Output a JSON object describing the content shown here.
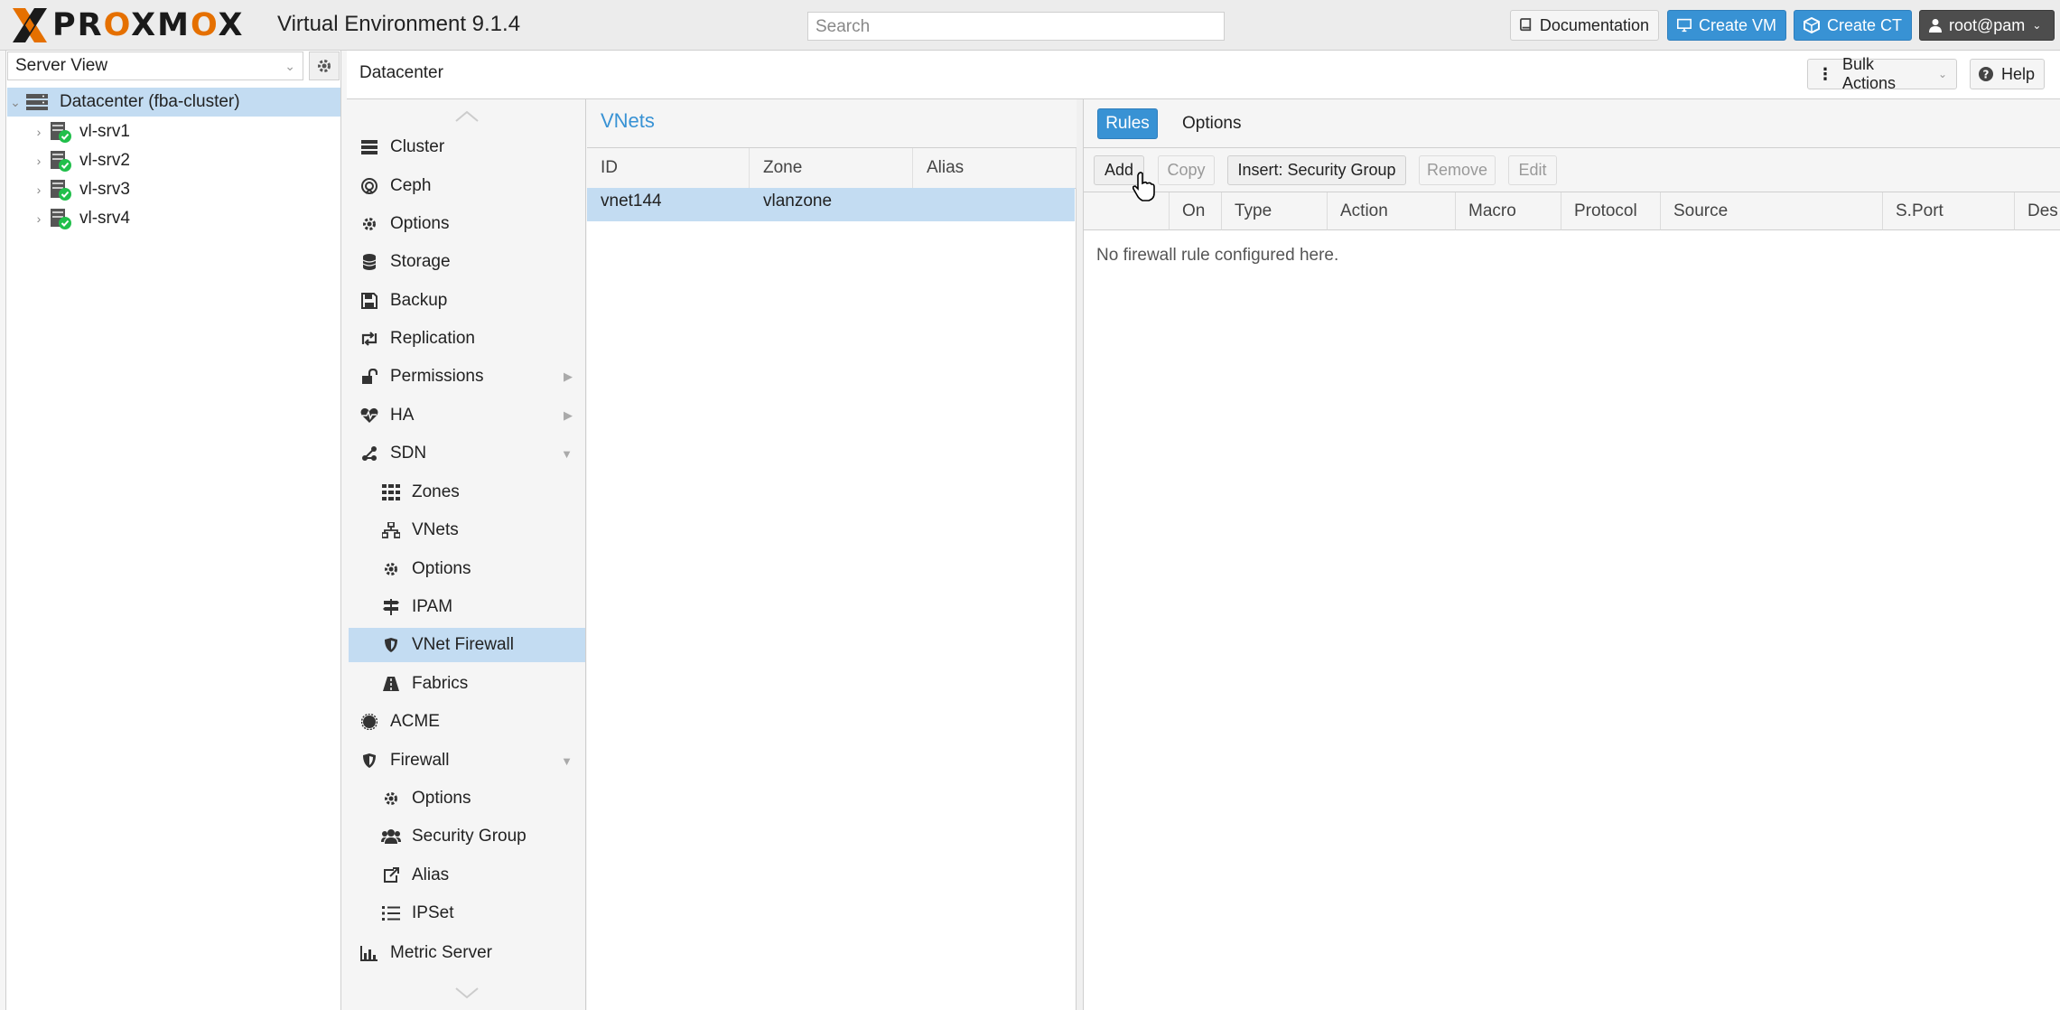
{
  "header": {
    "logo_text": "PROXMOX",
    "product_title": "Virtual Environment 9.1.4",
    "search_placeholder": "Search",
    "buttons": {
      "documentation": "Documentation",
      "create_vm": "Create VM",
      "create_ct": "Create CT",
      "user": "root@pam"
    },
    "accent_color": "#3892d4",
    "brand_color": "#e57000"
  },
  "resource_tree": {
    "view_select": "Server View",
    "datacenter": "Datacenter (fba-cluster)",
    "nodes": [
      "vl-srv1",
      "vl-srv2",
      "vl-srv3",
      "vl-srv4"
    ]
  },
  "content": {
    "title": "Datacenter",
    "bulk_actions": "Bulk Actions",
    "help": "Help"
  },
  "nav": {
    "items": [
      {
        "label": "Cluster",
        "icon": "server-icon"
      },
      {
        "label": "Ceph",
        "icon": "ceph-icon"
      },
      {
        "label": "Options",
        "icon": "gear-icon"
      },
      {
        "label": "Storage",
        "icon": "database-icon"
      },
      {
        "label": "Backup",
        "icon": "floppy-icon"
      },
      {
        "label": "Replication",
        "icon": "retweet-icon"
      },
      {
        "label": "Permissions",
        "icon": "unlock-icon"
      },
      {
        "label": "HA",
        "icon": "heartbeat-icon"
      },
      {
        "label": "SDN",
        "icon": "sdn-icon"
      },
      {
        "label": "Zones",
        "icon": "grid-icon"
      },
      {
        "label": "VNets",
        "icon": "network-icon"
      },
      {
        "label": "Options",
        "icon": "gear-icon"
      },
      {
        "label": "IPAM",
        "icon": "signpost-icon"
      },
      {
        "label": "VNet Firewall",
        "icon": "shield-icon"
      },
      {
        "label": "Fabrics",
        "icon": "road-icon"
      },
      {
        "label": "ACME",
        "icon": "certificate-icon"
      },
      {
        "label": "Firewall",
        "icon": "shield-icon"
      },
      {
        "label": "Options",
        "icon": "gear-icon"
      },
      {
        "label": "Security Group",
        "icon": "group-icon"
      },
      {
        "label": "Alias",
        "icon": "external-link-icon"
      },
      {
        "label": "IPSet",
        "icon": "list-icon"
      },
      {
        "label": "Metric Server",
        "icon": "bar-chart-icon"
      }
    ]
  },
  "vnets": {
    "title": "VNets",
    "columns": [
      "ID",
      "Zone",
      "Alias"
    ],
    "rows": [
      {
        "id": "vnet144",
        "zone": "vlanzone",
        "alias": ""
      }
    ]
  },
  "firewall": {
    "tabs": [
      "Rules",
      "Options"
    ],
    "toolbar": [
      "Add",
      "Copy",
      "Insert: Security Group",
      "Remove",
      "Edit"
    ],
    "columns": [
      "On",
      "Type",
      "Action",
      "Macro",
      "Protocol",
      "Source",
      "S.Port",
      "Des"
    ],
    "empty_text": "No firewall rule configured here."
  }
}
